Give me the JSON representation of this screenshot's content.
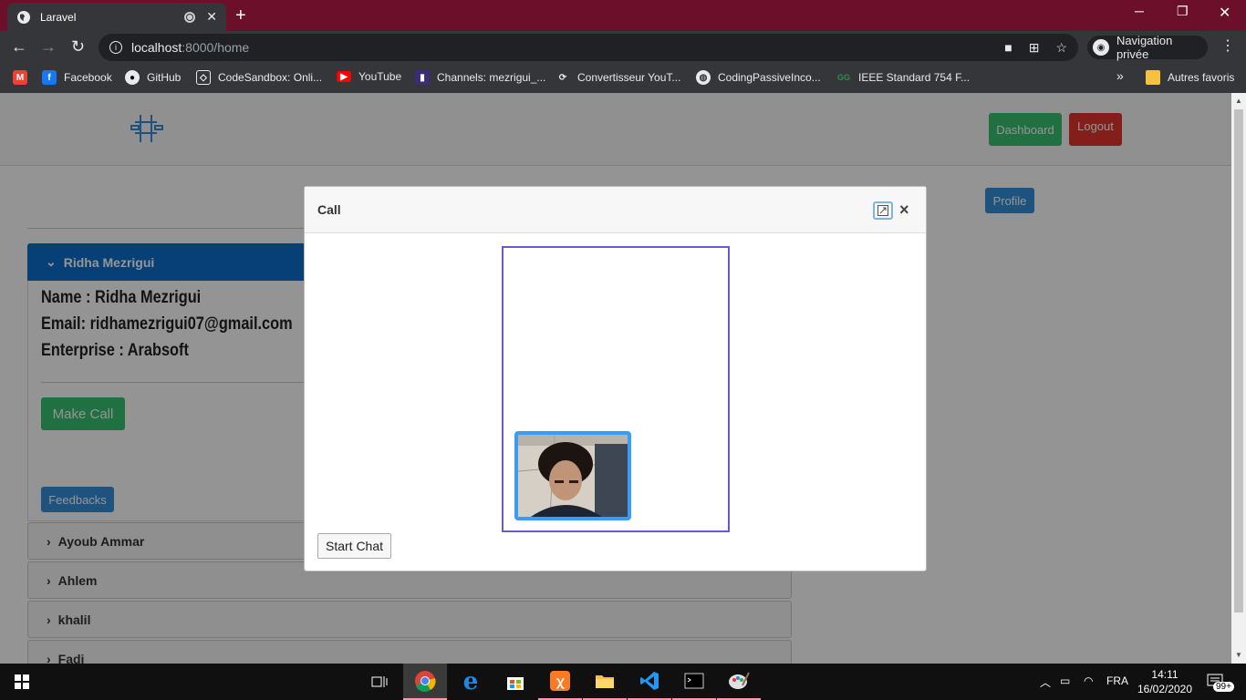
{
  "browser": {
    "tab_title": "Laravel",
    "url_host": "localhost",
    "url_rest": ":8000/home",
    "incognito_label": "Navigation privée",
    "bookmarks": [
      {
        "label": "",
        "icon": "gmail-icon"
      },
      {
        "label": "Facebook",
        "icon": "facebook-icon"
      },
      {
        "label": "GitHub",
        "icon": "github-icon"
      },
      {
        "label": "CodeSandbox: Onli...",
        "icon": "codesandbox-icon"
      },
      {
        "label": "YouTube",
        "icon": "youtube-icon"
      },
      {
        "label": "Channels: mezrigui_...",
        "icon": "channels-icon"
      },
      {
        "label": "Convertisseur YouT...",
        "icon": "converter-icon"
      },
      {
        "label": "CodingPassiveInco...",
        "icon": "globe-icon"
      },
      {
        "label": "IEEE Standard 754 F...",
        "icon": "gg-icon"
      }
    ],
    "other_bookmarks": "Autres favoris",
    "more_bookmarks": "»"
  },
  "navbar": {
    "dashboard_label": "Dashboard",
    "logout_label": "Logout",
    "profile_label": "Profile"
  },
  "contacts": {
    "open": {
      "name": "Ridha Mezrigui",
      "name_line": "Name : Ridha Mezrigui",
      "email_line": "Email: ridhamezrigui07@gmail.com",
      "enterprise_line": "Enterprise : Arabsoft",
      "call_label": "Make Call",
      "feedback_label": "Feedbacks"
    },
    "others": [
      "Ayoub Ammar",
      "Ahlem",
      "khalil",
      "Fadi"
    ]
  },
  "modal": {
    "title": "Call",
    "close": "×",
    "start_chat_label": "Start Chat"
  },
  "taskbar": {
    "language": "FRA",
    "time": "14:11",
    "date": "16/02/2020",
    "notifications": "99+"
  },
  "colors": {
    "titlebar": "#6b0f2b",
    "primary": "#0d6ecd",
    "success": "#38c172",
    "danger": "#e3342f",
    "info": "#3490dc"
  }
}
